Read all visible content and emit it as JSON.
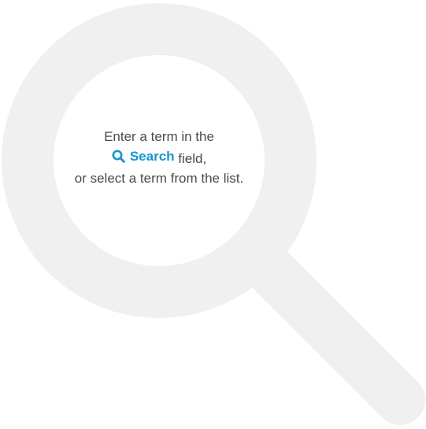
{
  "empty_state": {
    "line1": "Enter a term in the",
    "search_label": "Search",
    "line2_suffix": " field,",
    "line3": "or select a term from the list.",
    "search_icon": "search-icon",
    "background_icon": "magnifier-icon"
  },
  "colors": {
    "text": "#4a4a4a",
    "accent": "#1795d0",
    "background_icon": "#f0f0f0"
  }
}
